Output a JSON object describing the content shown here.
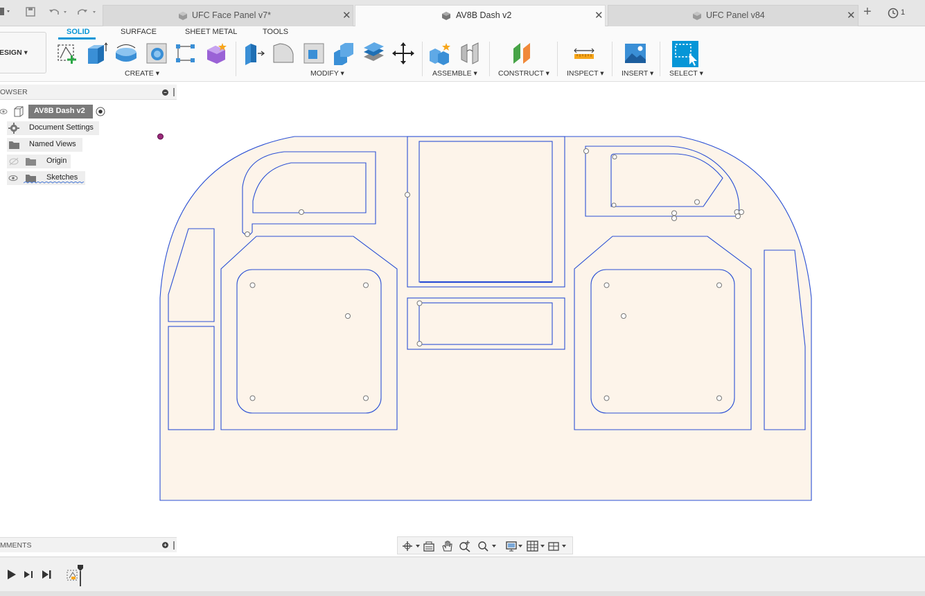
{
  "tabs": [
    {
      "label": "UFC Face Panel v7*",
      "active": false
    },
    {
      "label": "AV8B Dash v2",
      "active": true
    },
    {
      "label": "UFC Panel v84",
      "active": false
    }
  ],
  "tabbar": {
    "close_glyph": "✕",
    "new_tab_glyph": "+",
    "job_count": "1"
  },
  "workspace": {
    "mode": "DESIGN ▾",
    "mode_visible": "ESIGN ▾",
    "tabs": [
      "SOLID",
      "SURFACE",
      "SHEET METAL",
      "TOOLS"
    ],
    "active_tab": "SOLID"
  },
  "groups": {
    "create": "CREATE ▾",
    "modify": "MODIFY ▾",
    "assemble": "ASSEMBLE ▾",
    "construct": "CONSTRUCT ▾",
    "inspect": "INSPECT ▾",
    "insert": "INSERT ▾",
    "select": "SELECT ▾"
  },
  "browser": {
    "title": "OWSER",
    "root": "AV8B Dash v2",
    "items": [
      "Document Settings",
      "Named Views",
      "Origin",
      "Sketches"
    ]
  },
  "comments": {
    "title": "MMENTS"
  },
  "icons": {
    "accent": "#0696d7",
    "sketch_line": "#2a4fd4",
    "sketch_fill": "#fdf4ea"
  }
}
